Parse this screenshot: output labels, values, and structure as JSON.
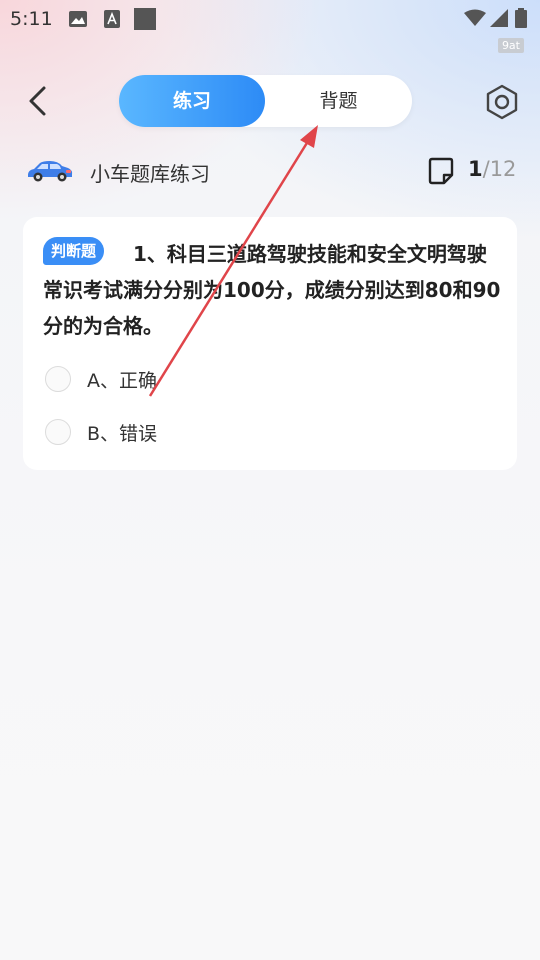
{
  "status_bar": {
    "time": "5:11",
    "net_label": "9at"
  },
  "header": {
    "tabs": [
      {
        "label": "练习"
      },
      {
        "label": "背题"
      }
    ]
  },
  "bank": {
    "title": "小车题库练习",
    "current": "1",
    "total": "/12"
  },
  "question": {
    "type_badge": "判断题",
    "text": "1、科目三道路驾驶技能和安全文明驾驶常识考试满分分别为100分，成绩分别达到80和90分的为合格。",
    "options": [
      {
        "label": "A、正确"
      },
      {
        "label": "B、错误"
      }
    ]
  },
  "colors": {
    "accent": "#2d8bf6",
    "annotation_arrow": "#e0454a"
  }
}
